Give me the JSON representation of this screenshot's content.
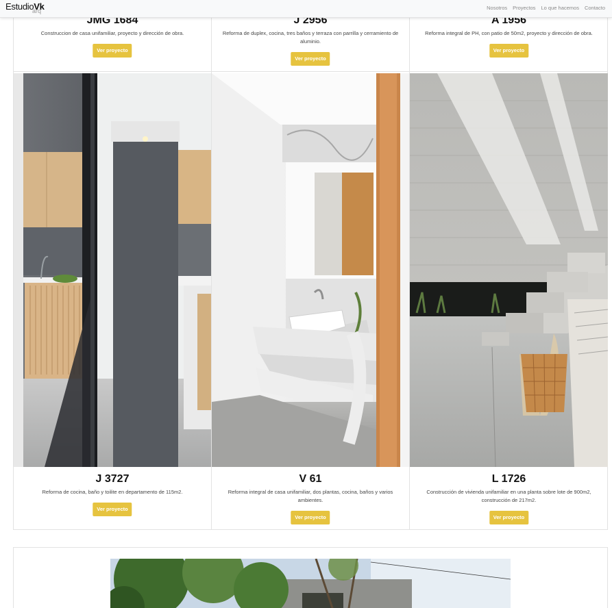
{
  "navbar": {
    "brand_main": "Estudio",
    "brand_bold": "Vk",
    "brand_sub": "arq",
    "links": [
      "Nosotros",
      "Proyectos",
      "Lo que hacemos",
      "Contacto"
    ]
  },
  "button_label": "Ver proyecto",
  "top_projects": [
    {
      "title": "JMG 1684",
      "desc": "Construccion de casa unifamiliar, proyecto y dirección de obra."
    },
    {
      "title": "J 2956",
      "desc": "Reforma de duplex, cocina, tres baños y terraza con parrilla y cerramiento de aluminio."
    },
    {
      "title": "A 1956",
      "desc": "Reforma integral de PH, con patio de 50m2, proyecto y dirección de obra."
    }
  ],
  "bottom_projects": [
    {
      "title": "J 3727",
      "desc": "Reforma de cocina, baño y toilite en departamento de 115m2."
    },
    {
      "title": "V 61",
      "desc": "Reforma integral de casa unifamiliar, dos plantas, cocina, baños y varios ambientes."
    },
    {
      "title": "L 1726",
      "desc": "Construcción de vivienda unifamiliar en una planta sobre lote de 900m2, construcción de 217m2."
    }
  ],
  "colors": {
    "button": "#e6c33f",
    "border": "#e2e2e2",
    "navbar": "#f8f9fa"
  }
}
